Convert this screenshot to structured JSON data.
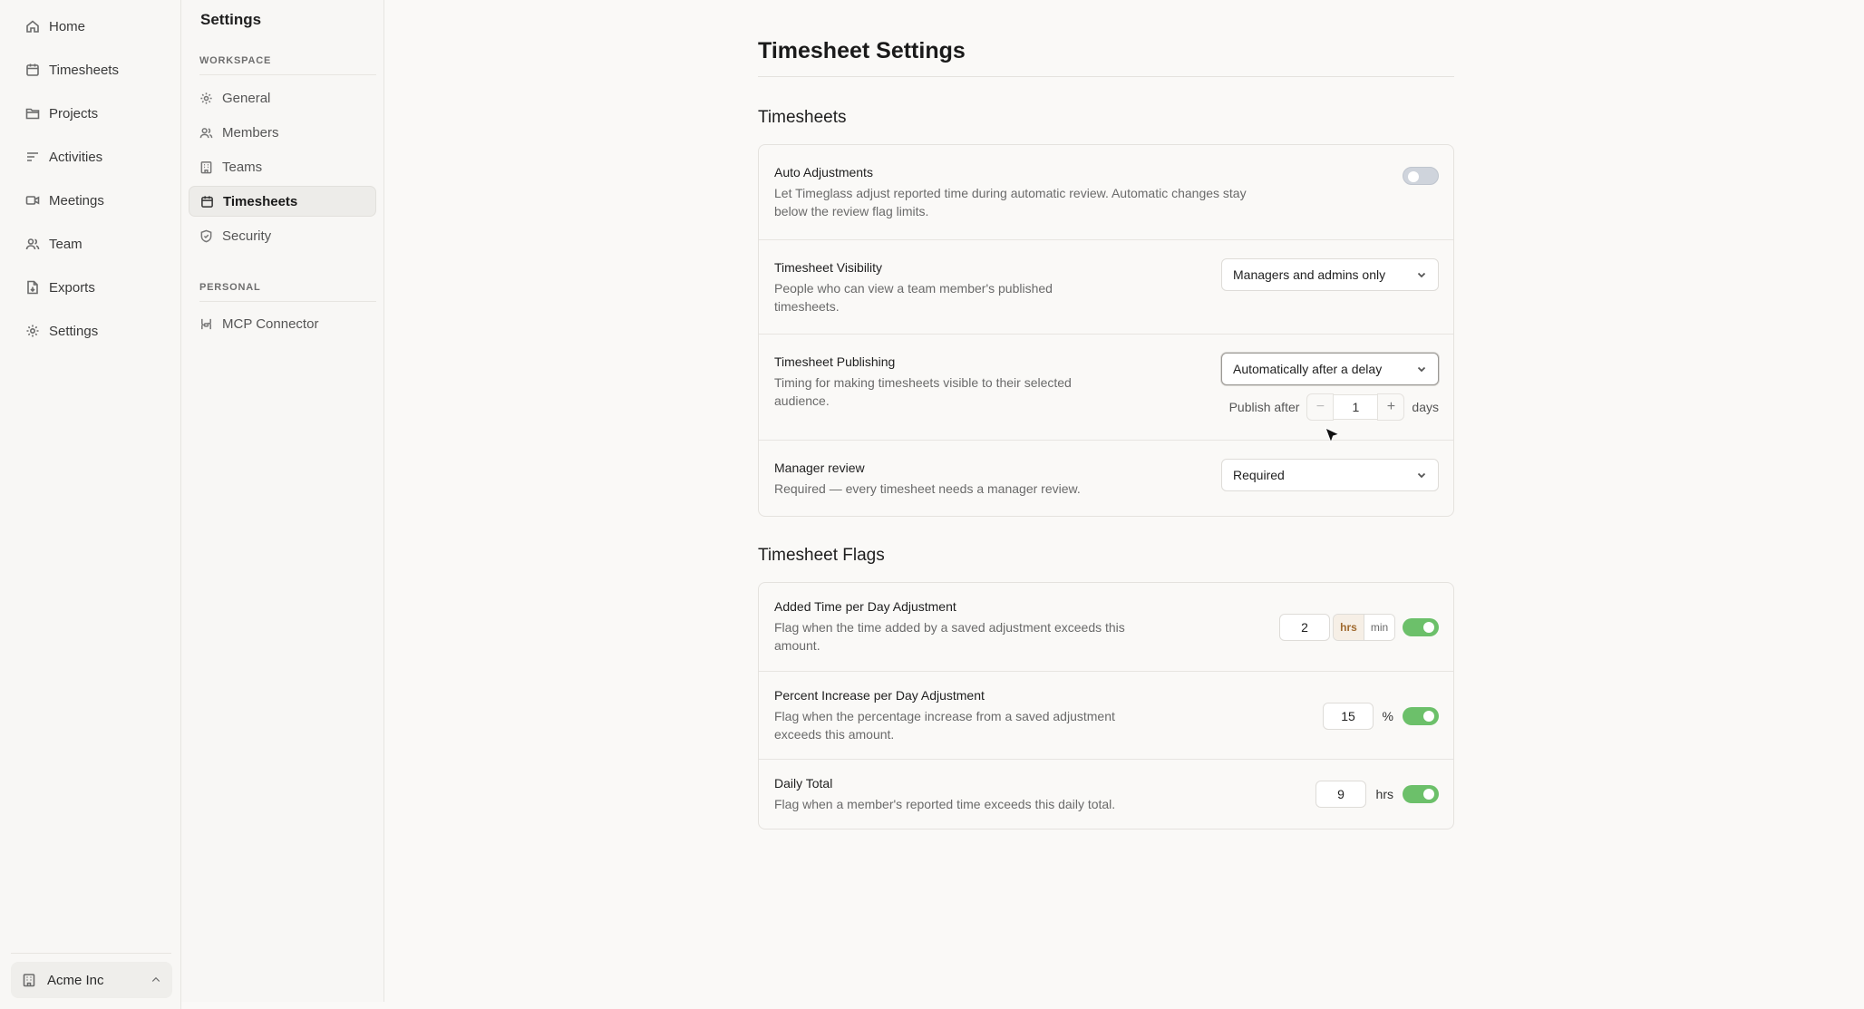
{
  "app_nav": {
    "items": [
      {
        "label": "Home",
        "icon": "home-icon"
      },
      {
        "label": "Timesheets",
        "icon": "calendar-icon"
      },
      {
        "label": "Projects",
        "icon": "folder-icon"
      },
      {
        "label": "Activities",
        "icon": "activities-icon"
      },
      {
        "label": "Meetings",
        "icon": "video-icon"
      },
      {
        "label": "Team",
        "icon": "users-icon"
      },
      {
        "label": "Exports",
        "icon": "file-export-icon"
      },
      {
        "label": "Settings",
        "icon": "gear-icon"
      }
    ],
    "org_name": "Acme Inc"
  },
  "settings_nav": {
    "title": "Settings",
    "workspace_label": "WORKSPACE",
    "workspace_items": [
      {
        "label": "General",
        "icon": "gear-icon"
      },
      {
        "label": "Members",
        "icon": "users-icon"
      },
      {
        "label": "Teams",
        "icon": "building-icon"
      },
      {
        "label": "Timesheets",
        "icon": "calendar-icon",
        "active": true
      },
      {
        "label": "Security",
        "icon": "shield-icon"
      }
    ],
    "personal_label": "PERSONAL",
    "personal_items": [
      {
        "label": "MCP Connector",
        "icon": "connector-icon"
      }
    ]
  },
  "page": {
    "title": "Timesheet Settings",
    "timesheets_section": {
      "heading": "Timesheets",
      "auto_adjustments": {
        "label": "Auto Adjustments",
        "desc_line1": "Let Timeglass adjust reported time during automatic review. Automatic changes stay",
        "desc_line2": "below the review flag limits.",
        "enabled": false
      },
      "visibility": {
        "label": "Timesheet Visibility",
        "desc_line1": "People who can view a team member's published",
        "desc_line2": "timesheets.",
        "value": "Managers and admins only"
      },
      "publishing": {
        "label": "Timesheet Publishing",
        "desc_line1": "Timing for making timesheets visible to their selected",
        "desc_line2": "audience.",
        "value": "Automatically after a delay",
        "publish_after_label": "Publish after",
        "minus": "−",
        "plus": "+",
        "delay_value": "1",
        "delay_unit": "days"
      },
      "manager_review": {
        "label": "Manager review",
        "desc": "Required — every timesheet needs a manager review.",
        "value": "Required"
      }
    },
    "flags_section": {
      "heading": "Timesheet Flags",
      "added_time": {
        "label": "Added Time per Day Adjustment",
        "desc_line1": "Flag when the time added by a saved adjustment exceeds this",
        "desc_line2": "amount.",
        "value": "2",
        "unit_hrs": "hrs",
        "unit_min": "min",
        "selected_unit": "hrs",
        "enabled": true
      },
      "percent_increase": {
        "label": "Percent Increase per Day Adjustment",
        "desc_line1": "Flag when the percentage increase from a saved adjustment",
        "desc_line2": "exceeds this amount.",
        "value": "15",
        "unit": "%",
        "enabled": true
      },
      "daily_total": {
        "label": "Daily Total",
        "desc": "Flag when a member's reported time exceeds this daily total.",
        "value": "9",
        "unit": "hrs",
        "enabled": true
      }
    }
  },
  "colors": {
    "toggle_on": "#6cc06a",
    "toggle_off": "#cfd4dc",
    "accent_unit": "#a06a2f"
  }
}
